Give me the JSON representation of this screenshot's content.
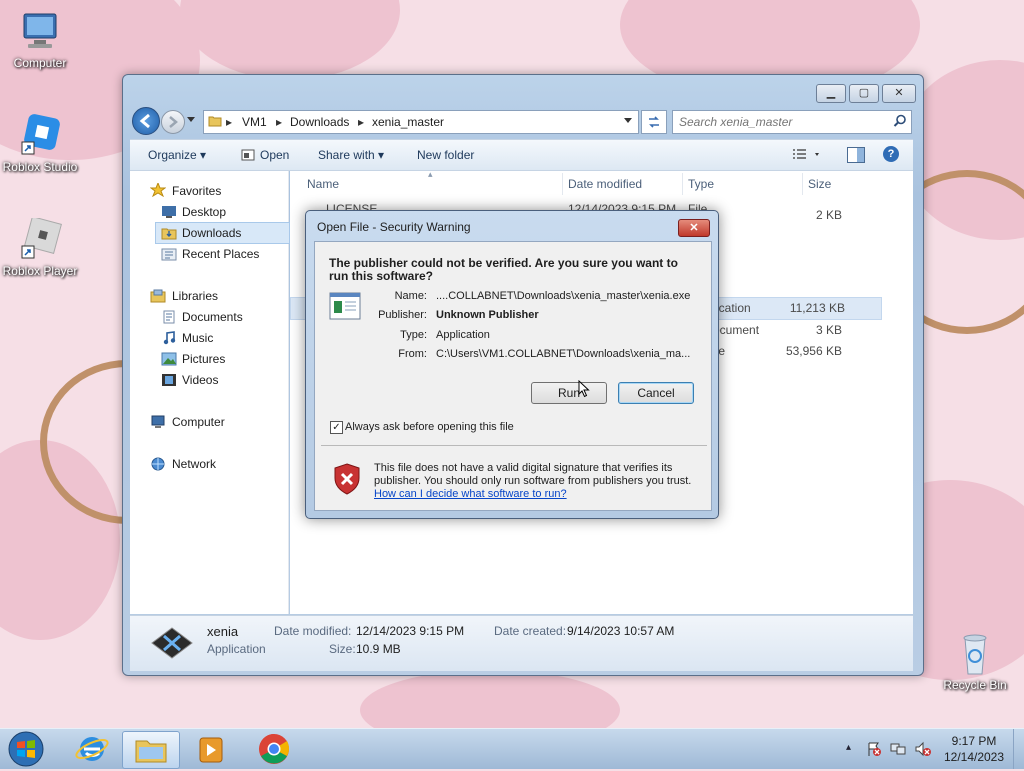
{
  "desktop": {
    "icons": [
      {
        "label": "Computer"
      },
      {
        "label": "Roblox Studio"
      },
      {
        "label": "Roblox Player"
      },
      {
        "label": "Recycle Bin"
      }
    ]
  },
  "explorer": {
    "breadcrumb": [
      "VM1",
      "Downloads",
      "xenia_master"
    ],
    "search_placeholder": "Search xenia_master",
    "toolbar": {
      "organize": "Organize",
      "open": "Open",
      "share_with": "Share with",
      "new_folder": "New folder"
    },
    "nav": {
      "favorites": "Favorites",
      "desktop": "Desktop",
      "downloads": "Downloads",
      "recent_places": "Recent Places",
      "libraries": "Libraries",
      "documents": "Documents",
      "music": "Music",
      "pictures": "Pictures",
      "videos": "Videos",
      "computer": "Computer",
      "network": "Network"
    },
    "columns": {
      "name": "Name",
      "date": "Date modified",
      "type": "Type",
      "size": "Size"
    },
    "rows": [
      {
        "name": "LICENSE",
        "date": "12/14/2023 9:15 PM",
        "type": "File",
        "size": "2 KB"
      },
      {
        "name": "",
        "date": "",
        "type": "ication",
        "size": "11,213 KB"
      },
      {
        "name": "",
        "date": "",
        "type": "ocument",
        "size": "3 KB"
      },
      {
        "name": "",
        "date": "",
        "type": "ile",
        "size": "53,956 KB"
      }
    ],
    "details": {
      "name": "xenia",
      "type": "Application",
      "date_modified_label": "Date modified:",
      "date_modified": "12/14/2023 9:15 PM",
      "date_created_label": "Date created:",
      "date_created": "9/14/2023 10:57 AM",
      "size_label": "Size:",
      "size": "10.9 MB"
    }
  },
  "dialog": {
    "title": "Open File - Security Warning",
    "question": "The publisher could not be verified.  Are you sure you want to run this software?",
    "fields": {
      "name_label": "Name:",
      "name": "....COLLABNET\\Downloads\\xenia_master\\xenia.exe",
      "publisher_label": "Publisher:",
      "publisher": "Unknown Publisher",
      "type_label": "Type:",
      "type": "Application",
      "from_label": "From:",
      "from": "C:\\Users\\VM1.COLLABNET\\Downloads\\xenia_ma..."
    },
    "run_button": "Run",
    "cancel_button": "Cancel",
    "always_ask": "Always ask before opening this file",
    "warning_text": "This file does not have a valid digital signature that verifies its publisher.  You should only run software from publishers you trust.",
    "help_link": "How can I decide what software to run?"
  },
  "taskbar": {
    "time": "9:17 PM",
    "date": "12/14/2023"
  }
}
